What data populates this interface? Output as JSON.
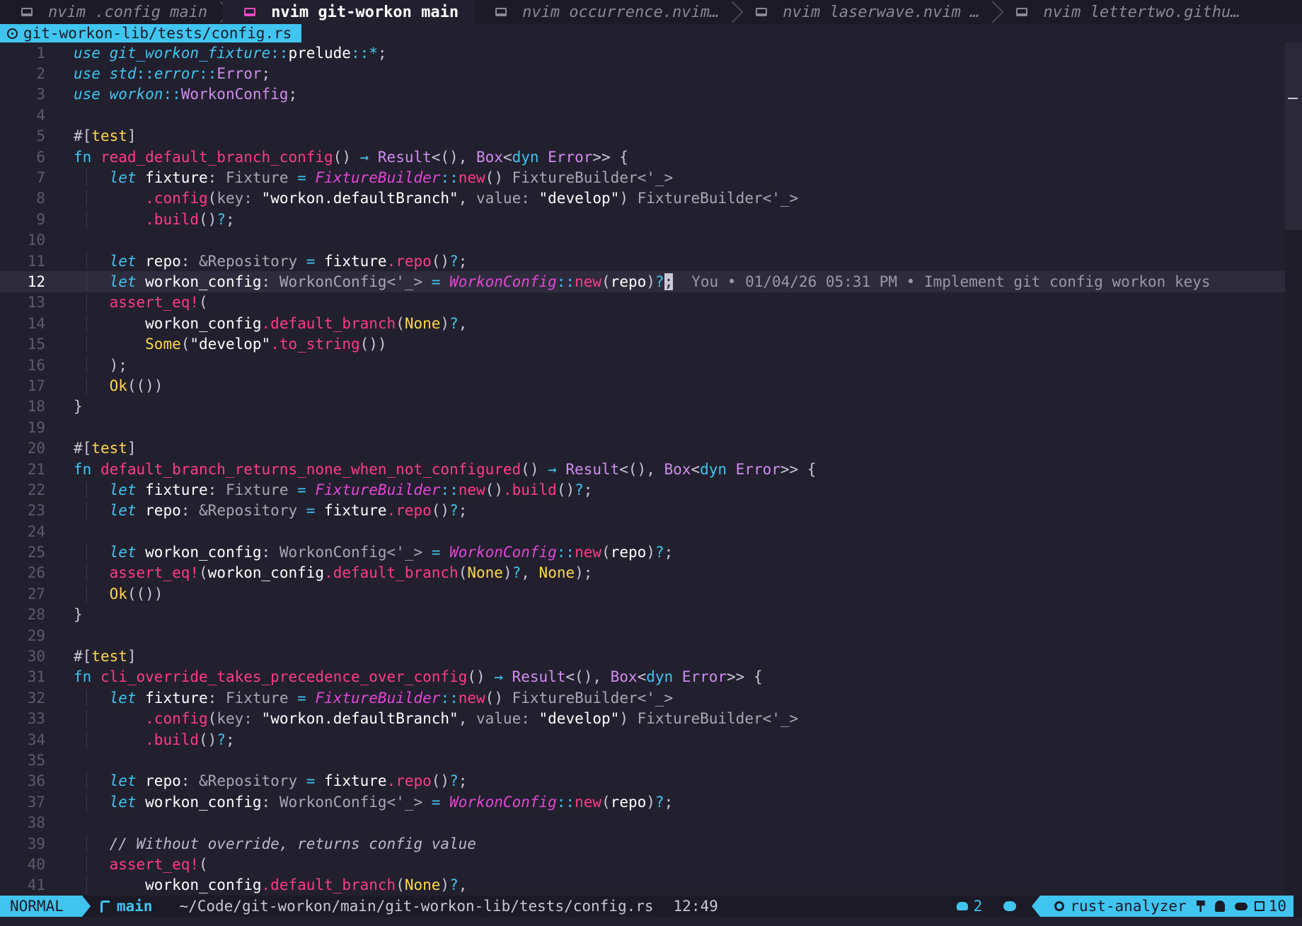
{
  "tabs": [
    {
      "label": "nvim .config main",
      "active": false
    },
    {
      "label": "nvim git-workon main",
      "active": true
    },
    {
      "label": "nvim occurrence.nvim…",
      "active": false
    },
    {
      "label": "nvim laserwave.nvim …",
      "active": false
    },
    {
      "label": "nvim lettertwo.githu…",
      "active": false
    }
  ],
  "file_path_tab": "git-workon-lib/tests/config.rs",
  "blame": "You • 01/04/26 05:31 PM • Implement git config workon keys",
  "lines": [
    "1",
    "2",
    "3",
    "4",
    "5",
    "6",
    "7",
    "8",
    "9",
    "10",
    "11",
    "12",
    "13",
    "14",
    "15",
    "16",
    "17",
    "18",
    "19",
    "20",
    "21",
    "22",
    "23",
    "24",
    "25",
    "26",
    "27",
    "28",
    "29",
    "30",
    "31",
    "32",
    "33",
    "34",
    "35",
    "36",
    "37",
    "38",
    "39",
    "40",
    "41"
  ],
  "statusline": {
    "mode": "NORMAL",
    "branch": "main",
    "path": "~/Code/git-workon/main/git-workon-lib/tests/config.rs",
    "position": "12:49",
    "diagnostics_count": "2",
    "lsp": "rust-analyzer",
    "count": "10"
  },
  "colors": {
    "background": "#22202e",
    "accent": "#40c4f0",
    "pink": "#ff3a8a",
    "magenta": "#e247d6",
    "yellow": "#ffd64a"
  }
}
